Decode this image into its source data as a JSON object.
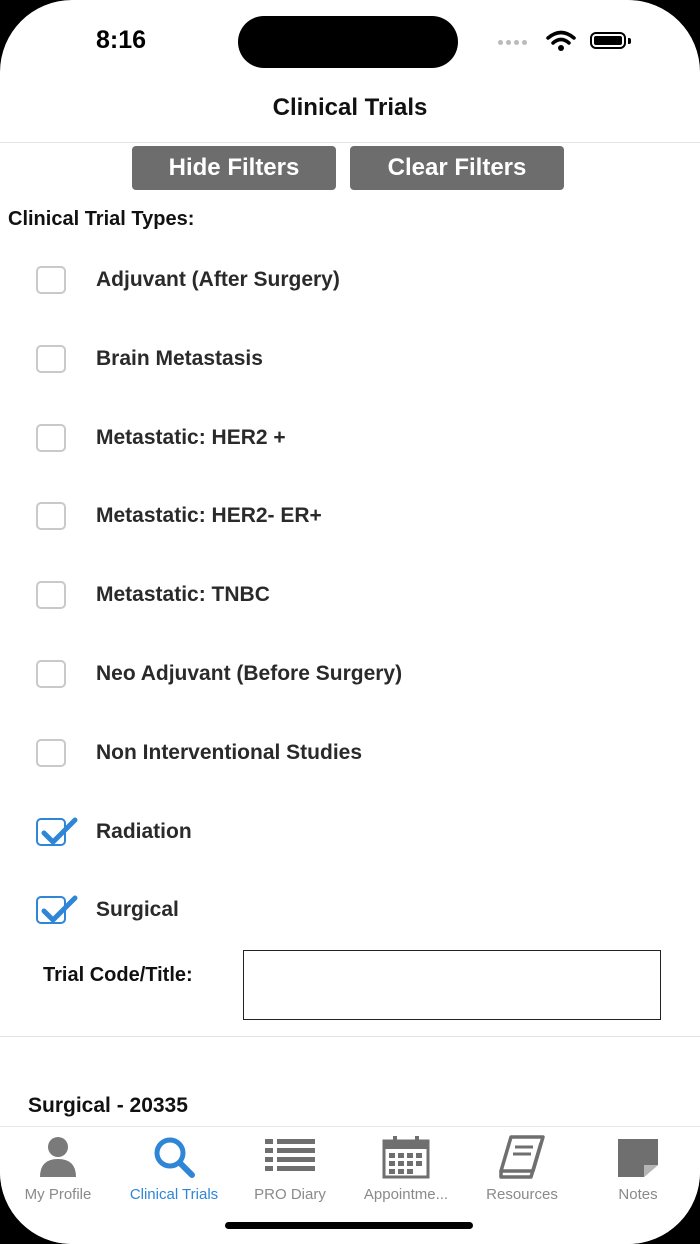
{
  "status_bar": {
    "time": "8:16"
  },
  "nav": {
    "title": "Clinical Trials"
  },
  "filters": {
    "hide_label": "Hide Filters",
    "clear_label": "Clear Filters",
    "types_label": "Clinical Trial Types:",
    "types": [
      {
        "label": "Adjuvant (After Surgery)",
        "checked": false
      },
      {
        "label": "Brain Metastasis",
        "checked": false
      },
      {
        "label": "Metastatic: HER2 +",
        "checked": false
      },
      {
        "label": "Metastatic: HER2- ER+",
        "checked": false
      },
      {
        "label": "Metastatic: TNBC",
        "checked": false
      },
      {
        "label": "Neo Adjuvant (Before Surgery)",
        "checked": false
      },
      {
        "label": "Non Interventional Studies",
        "checked": false
      },
      {
        "label": "Radiation",
        "checked": true
      },
      {
        "label": "Surgical",
        "checked": true
      }
    ],
    "code_label": "Trial Code/Title:",
    "code_value": ""
  },
  "results": [
    {
      "title": "Surgical - 20335"
    }
  ],
  "tabs": [
    {
      "label": "My Profile",
      "icon": "person-icon",
      "active": false
    },
    {
      "label": "Clinical Trials",
      "icon": "search-icon",
      "active": true
    },
    {
      "label": "PRO Diary",
      "icon": "list-icon",
      "active": false
    },
    {
      "label": "Appointme...",
      "icon": "calendar-icon",
      "active": false
    },
    {
      "label": "Resources",
      "icon": "book-icon",
      "active": false
    },
    {
      "label": "Notes",
      "icon": "note-icon",
      "active": false
    }
  ],
  "colors": {
    "accent": "#2f86d6",
    "button_bg": "#6d6d6d",
    "inactive_tab": "#8a8a8a"
  }
}
